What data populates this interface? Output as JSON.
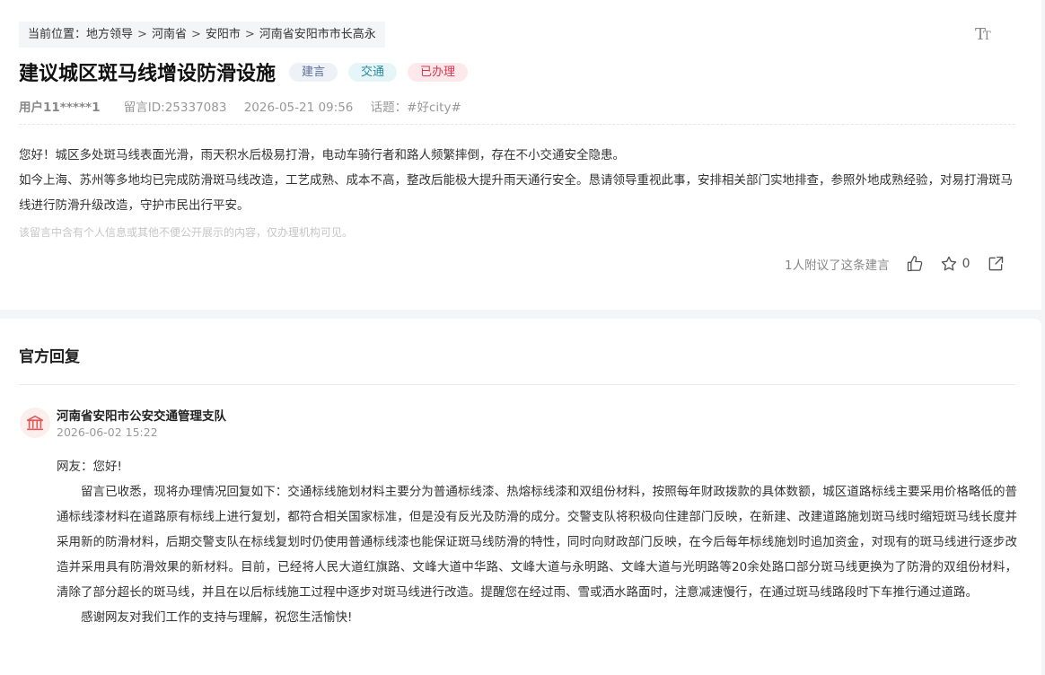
{
  "breadcrumb": {
    "prefix": "当前位置：",
    "items": [
      "地方领导",
      "河南省",
      "安阳市",
      "河南省安阳市市长高永"
    ],
    "separator": ">"
  },
  "font_size_button": {
    "large": "T",
    "small": "T"
  },
  "post": {
    "title": "建议城区斑马线增设防滑设施",
    "tags": [
      {
        "label": "建言",
        "color": "#5a6f96"
      },
      {
        "label": "交通",
        "color": "#2a8a9b"
      },
      {
        "label": "已办理",
        "color": "#e0334b"
      }
    ],
    "user": "用户11*****1",
    "message_id": "留言ID:25337083",
    "datetime": "2026-05-21 09:56",
    "topic_prefix": "话题：",
    "topic": "#好city#",
    "content": [
      "您好！城区多处斑马线表面光滑，雨天积水后极易打滑，电动车骑行者和路人频繁摔倒，存在不小交通安全隐患。",
      "如今上海、苏州等多地均已完成防滑斑马线改造，工艺成熟、成本不高，整改后能极大提升雨天通行安全。恳请领导重视此事，安排相关部门实地排查，参照外地成熟经验，对易打滑斑马线进行防滑升级改造，守护市民出行平安。"
    ],
    "notice": "该留言中含有个人信息或其他不便公开展示的内容，仅办理机构可见。",
    "agree_text": "1人附议了这条建言",
    "favorite_count": "0"
  },
  "reply": {
    "section_title": "官方回复",
    "org_name": "河南省安阳市公安交通管理支队",
    "datetime": "2026-06-02 15:22",
    "greeting": "网友：您好!",
    "body": "留言已收悉，现将办理情况回复如下：交通标线施划材料主要分为普通标线漆、热熔标线漆和双组份材料，按照每年财政拨款的具体数额，城区道路标线主要采用价格略低的普通标线漆材料在道路原有标线上进行复划，都符合相关国家标准，但是没有反光及防滑的成分。交警支队将积极向住建部门反映，在新建、改建道路施划斑马线时缩短斑马线长度并采用新的防滑材料，后期交警支队在标线复划时仍使用普通标线漆也能保证斑马线防滑的特性，同时向财政部门反映，在今后每年标线施划时追加资金，对现有的斑马线进行逐步改造并采用具有防滑效果的新材料。目前，已经将人民大道红旗路、文峰大道中华路、文峰大道与永明路、文峰大道与光明路等20余处路口部分斑马线更换为了防滑的双组份材料，清除了部分超长的斑马线，并且在以后标线施工过程中逐步对斑马线进行改造。提醒您在经过雨、雪或洒水路面时，注意减速慢行，在通过斑马线路段时下车推行通过道路。",
    "closing": "感谢网友对我们工作的支持与理解，祝您生活愉快!"
  },
  "colors": {
    "accent_red": "#e0334b",
    "icon_gray": "#555555",
    "avatar_icon": "#e05a5a"
  },
  "icons": {
    "like": "thumbs-up-icon",
    "favorite": "star-icon",
    "share": "share-icon",
    "avatar": "government-building-icon",
    "font_size": "font-size-icon"
  }
}
